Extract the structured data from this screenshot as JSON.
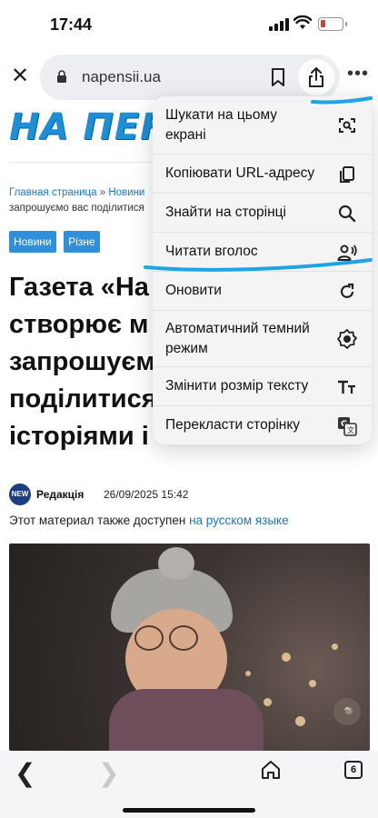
{
  "status_bar": {
    "time": "17:44"
  },
  "browser": {
    "url": "napensii.ua",
    "active_tab_count": "6"
  },
  "page": {
    "logo_text": "НА ПЕНСІЇ",
    "breadcrumb": {
      "home": "Главная страница",
      "separator": " » ",
      "section": "Новини",
      "continuation": "запрошуємо вас поділитися"
    },
    "tags": [
      "Новини",
      "Різне"
    ],
    "title_lines": [
      "Газета «На",
      "створює м",
      "запрошуєм",
      "поділитися",
      "історіями і"
    ],
    "author": {
      "avatar_text": "NEW",
      "name": "Редакція",
      "date": "26/09/2025 15:42"
    },
    "also_available": {
      "text": "Этот материал также доступен ",
      "link": "на русском языке"
    }
  },
  "menu": {
    "items": [
      {
        "label": "Шукати на цьому екрані",
        "icon": "screen-search-icon"
      },
      {
        "label": "Копіювати URL-адресу",
        "icon": "copy-icon"
      },
      {
        "label": "Знайти на сторінці",
        "icon": "search-icon"
      },
      {
        "label": "Читати вголос",
        "icon": "read-aloud-icon"
      },
      {
        "label": "Оновити",
        "icon": "reload-icon"
      },
      {
        "label": "Автоматичний темний режим",
        "icon": "dark-mode-icon"
      },
      {
        "label": "Змінити розмір тексту",
        "icon": "text-size-icon"
      },
      {
        "label": "Перекласти сторінку",
        "icon": "translate-icon"
      }
    ]
  },
  "colors": {
    "accent_blue": "#1d8fd6",
    "link_blue": "#1d76c2",
    "annotation_blue": "#1ea3e6",
    "battery_red": "#e5383b"
  }
}
